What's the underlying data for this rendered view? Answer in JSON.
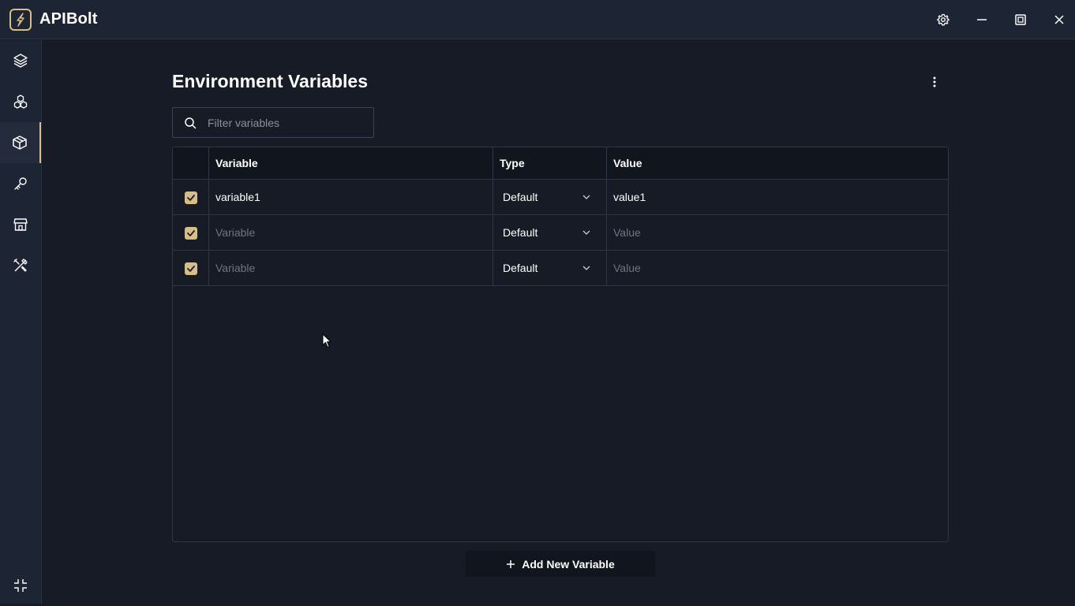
{
  "app": {
    "title": "APIBolt"
  },
  "window_controls": [
    {
      "name": "settings-icon"
    },
    {
      "name": "minimize-icon"
    },
    {
      "name": "maximize-icon"
    },
    {
      "name": "close-icon"
    }
  ],
  "sidebar": {
    "items": [
      {
        "icon": "layers-icon",
        "active": false
      },
      {
        "icon": "cubes-icon",
        "active": false
      },
      {
        "icon": "box-icon",
        "active": true
      },
      {
        "icon": "key-icon",
        "active": false
      },
      {
        "icon": "store-icon",
        "active": false
      },
      {
        "icon": "tools-icon",
        "active": false
      }
    ],
    "bottom_icon": "collapse-icon"
  },
  "page": {
    "title": "Environment Variables",
    "search": {
      "placeholder": "Filter variables",
      "value": ""
    }
  },
  "table": {
    "headers": {
      "variable": "Variable",
      "type": "Type",
      "value": "Value"
    },
    "rows": [
      {
        "checked": true,
        "variable": "variable1",
        "variable_placeholder": "Variable",
        "type": "Default",
        "value": "value1",
        "value_placeholder": "Value"
      },
      {
        "checked": true,
        "variable": "",
        "variable_placeholder": "Variable",
        "type": "Default",
        "value": "",
        "value_placeholder": "Value"
      },
      {
        "checked": true,
        "variable": "",
        "variable_placeholder": "Variable",
        "type": "Default",
        "value": "",
        "value_placeholder": "Value"
      }
    ]
  },
  "actions": {
    "add_label": "Add New Variable"
  },
  "colors": {
    "accent": "#d9bd86",
    "background": "#161b26",
    "panel": "#1d2433",
    "header": "#11151d",
    "border": "#2f3646"
  }
}
